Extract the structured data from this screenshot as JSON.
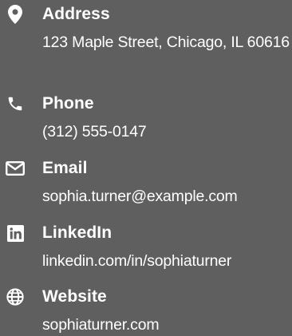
{
  "contacts": {
    "address": {
      "label": "Address",
      "value": "123 Maple Street, Chicago, IL 60616",
      "icon": "map-marker-icon"
    },
    "phone": {
      "label": "Phone",
      "value": "(312) 555-0147",
      "icon": "phone-icon"
    },
    "email": {
      "label": "Email",
      "value": "sophia.turner@example.com",
      "icon": "envelope-icon"
    },
    "linkedin": {
      "label": "LinkedIn",
      "value": "linkedin.com/in/sophiaturner",
      "icon": "linkedin-icon"
    },
    "website": {
      "label": "Website",
      "value": "sophiaturner.com",
      "icon": "globe-icon"
    }
  },
  "colors": {
    "background": "#5f5f5f",
    "text": "#ffffff"
  }
}
